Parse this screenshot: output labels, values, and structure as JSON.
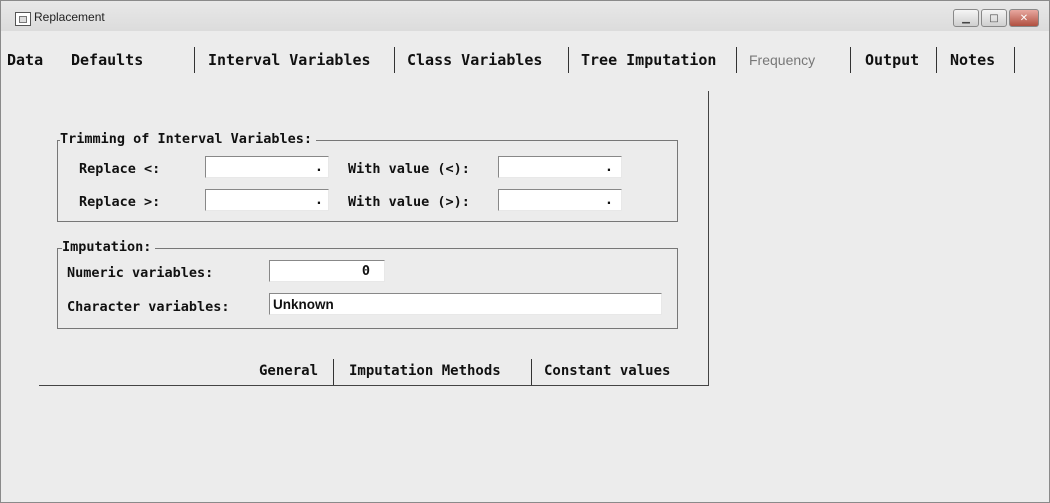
{
  "window": {
    "title": "Replacement"
  },
  "tabs": [
    {
      "label": "Data"
    },
    {
      "label": "Defaults"
    },
    {
      "label": "Interval Variables"
    },
    {
      "label": "Class Variables"
    },
    {
      "label": "Tree Imputation"
    },
    {
      "label": "Frequency"
    },
    {
      "label": "Output"
    },
    {
      "label": "Notes"
    }
  ],
  "trimming": {
    "group_label": "Trimming of Interval Variables:",
    "replace_lt_label": "Replace <:",
    "replace_lt_value": ".",
    "with_lt_label": "With value (<):",
    "with_lt_value": ".",
    "replace_gt_label": "Replace >:",
    "replace_gt_value": ".",
    "with_gt_label": "With value (>):",
    "with_gt_value": "."
  },
  "imputation": {
    "group_label": "Imputation:",
    "numeric_label": "Numeric variables:",
    "numeric_value": "0",
    "character_label": "Character variables:",
    "character_value": "Unknown"
  },
  "subtabs": [
    {
      "label": "General"
    },
    {
      "label": "Imputation Methods"
    },
    {
      "label": "Constant values"
    }
  ]
}
